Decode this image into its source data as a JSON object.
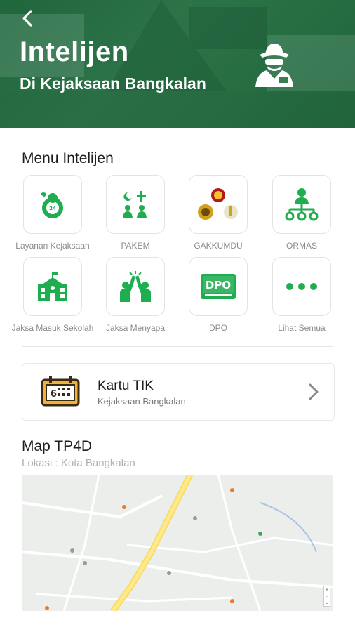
{
  "header": {
    "title": "Intelijen",
    "subtitle": "Di Kejaksaan Bangkalan"
  },
  "menu": {
    "title": "Menu Intelijen",
    "items": [
      {
        "label": "Layanan Kejaksaan",
        "icon": "service-icon"
      },
      {
        "label": "PAKEM",
        "icon": "religion-icon"
      },
      {
        "label": "GAKKUMDU",
        "icon": "emblems-icon"
      },
      {
        "label": "ORMAS",
        "icon": "organization-icon"
      },
      {
        "label": "Jaksa Masuk Sekolah",
        "icon": "school-icon"
      },
      {
        "label": "Jaksa Menyapa",
        "icon": "high-five-icon"
      },
      {
        "label": "DPO",
        "icon": "dpo-icon"
      },
      {
        "label": "Lihat Semua",
        "icon": "more-icon"
      }
    ]
  },
  "card": {
    "title": "Kartu TIK",
    "subtitle": "Kejaksaan Bangkalan"
  },
  "map": {
    "title": "Map TP4D",
    "location": "Lokasi : Kota Bangkalan"
  },
  "icon_text": {
    "dpo": "DPO",
    "card_number": "6"
  },
  "colors": {
    "accent": "#1fae4f",
    "header_overlay": "#146e3c",
    "label_gray": "#8a8a8a"
  }
}
